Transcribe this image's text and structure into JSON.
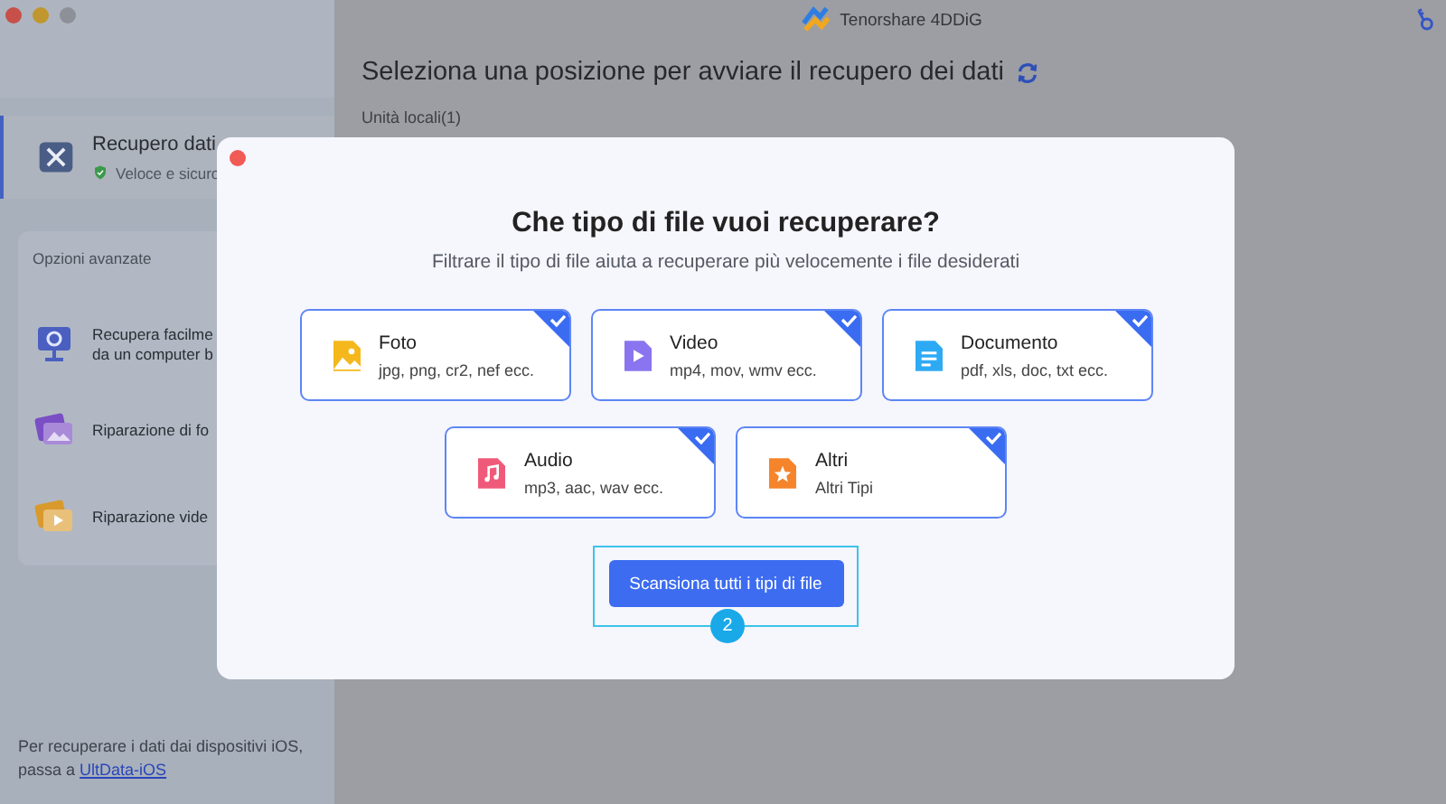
{
  "window": {
    "title": "Tenorshare 4DDiG"
  },
  "sidebar": {
    "main_item": {
      "title": "Recupero dati",
      "subtitle": "Veloce e sicuro",
      "selected": true
    },
    "advanced": {
      "heading": "Opzioni avanzate",
      "items": [
        {
          "kind": "computer",
          "lines": [
            "Recupera facilme",
            "da un computer b"
          ]
        },
        {
          "kind": "photo",
          "lines": [
            "Riparazione di fo"
          ]
        },
        {
          "kind": "video",
          "lines": [
            "Riparazione vide"
          ]
        }
      ]
    },
    "footer": {
      "text": "Per recuperare i dati dai dispositivi iOS, passa a ",
      "link": "UltData-iOS"
    }
  },
  "main": {
    "heading": "Seleziona una posizione per avviare il recupero dei dati",
    "section": "Unità locali(1)"
  },
  "dialog": {
    "title": "Che tipo di file vuoi recuperare?",
    "subtitle": "Filtrare il tipo di file aiuta a recuperare più velocemente i file desiderati",
    "file_types": [
      {
        "kind": "photo",
        "name": "Foto",
        "extensions": "jpg, png, cr2, nef ecc.",
        "checked": true
      },
      {
        "kind": "video",
        "name": "Video",
        "extensions": "mp4, mov, wmv ecc.",
        "checked": true
      },
      {
        "kind": "document",
        "name": "Documento",
        "extensions": "pdf, xls, doc, txt ecc.",
        "checked": true
      },
      {
        "kind": "audio",
        "name": "Audio",
        "extensions": "mp3, aac, wav ecc.",
        "checked": true
      },
      {
        "kind": "other",
        "name": "Altri",
        "extensions": "Altri Tipi",
        "checked": true
      }
    ],
    "scan_button": "Scansiona tutti i tipi di file",
    "step_badge": "2"
  }
}
